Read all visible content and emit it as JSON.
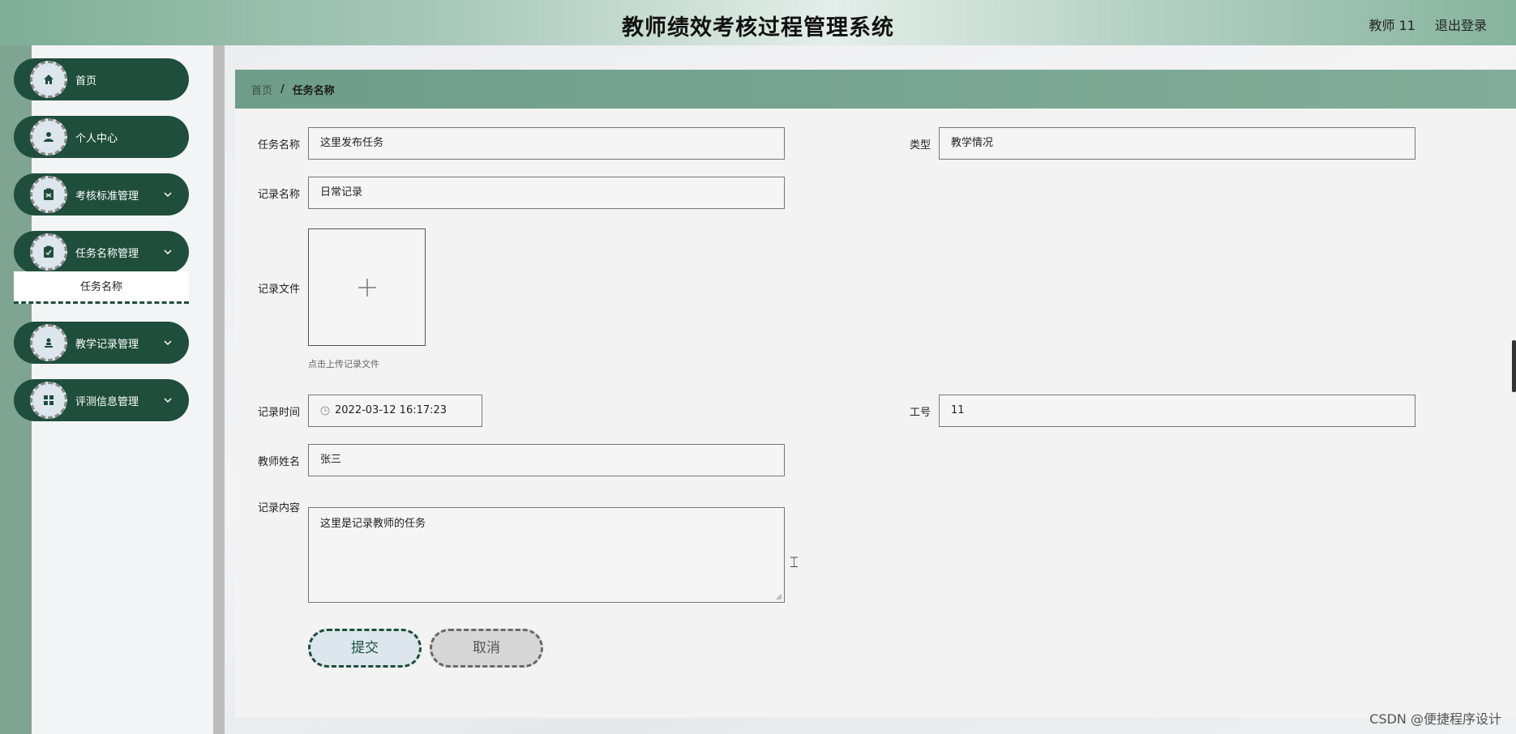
{
  "header": {
    "title": "教师绩效考核过程管理系统",
    "user": "教师 11",
    "logout": "退出登录"
  },
  "sidebar": {
    "items": [
      {
        "label": "首页",
        "icon": "home-icon"
      },
      {
        "label": "个人中心",
        "icon": "user-icon"
      },
      {
        "label": "考核标准管理",
        "icon": "clipboard-icon"
      },
      {
        "label": "任务名称管理",
        "icon": "clipboard-check-icon"
      },
      {
        "label": "教学记录管理",
        "icon": "person-stamp-icon"
      },
      {
        "label": "评测信息管理",
        "icon": "grid-icon"
      }
    ],
    "submenu_label": "任务名称"
  },
  "breadcrumb": {
    "home": "首页",
    "separator": "/",
    "current": "任务名称"
  },
  "form": {
    "task_name_label": "任务名称",
    "task_name_value": "这里发布任务",
    "type_label": "类型",
    "type_value": "教学情况",
    "record_name_label": "记录名称",
    "record_name_value": "日常记录",
    "record_file_label": "记录文件",
    "upload_hint": "点击上传记录文件",
    "record_time_label": "记录时间",
    "record_time_value": "2022-03-12 16:17:23",
    "job_no_label": "工号",
    "job_no_value": "11",
    "teacher_name_label": "教师姓名",
    "teacher_name_value": "张三",
    "record_content_label": "记录内容",
    "record_content_value": "这里是记录教师的任务",
    "submit_label": "提交",
    "cancel_label": "取消"
  },
  "watermark": "CSDN @便捷程序设计",
  "colors": {
    "sidebar_item": "#1f4e3d",
    "breadcrumb_bar": "#76a390",
    "background": "#7fa592"
  }
}
